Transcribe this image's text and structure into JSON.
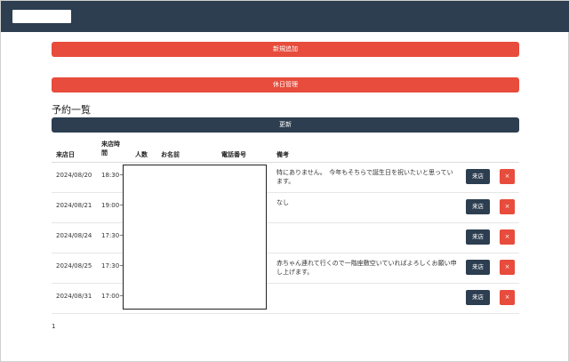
{
  "actions": {
    "new_label": "新規追加",
    "holiday_label": "休日管理"
  },
  "section_title": "予約一覧",
  "update_label": "更新",
  "table": {
    "headers": {
      "date": "来店日",
      "time_line1": "来店時",
      "time_line2": "間",
      "people": "人数",
      "name": "お名前",
      "phone": "電話番号",
      "note": "備考"
    },
    "rows": [
      {
        "date": "2024/08/20",
        "time": "18:30~",
        "note": "特にありません。　今年もそちらで誕生日を祝いたいと思っています。"
      },
      {
        "date": "2024/08/21",
        "time": "19:00~",
        "note": "なし"
      },
      {
        "date": "2024/08/24",
        "time": "17:30~",
        "note": ""
      },
      {
        "date": "2024/08/25",
        "time": "17:30~",
        "note": "赤ちゃん連れて行くので一階座敷空いていればよろしくお願い申し上げます。"
      },
      {
        "date": "2024/08/31",
        "time": "17:00~",
        "note": ""
      }
    ],
    "visit_label": "来店",
    "delete_label": "×"
  },
  "pagination": {
    "current": "1"
  },
  "colors": {
    "navbar": "#2c3e50",
    "danger": "#e74c3c",
    "primary_dark": "#2c3e50"
  }
}
